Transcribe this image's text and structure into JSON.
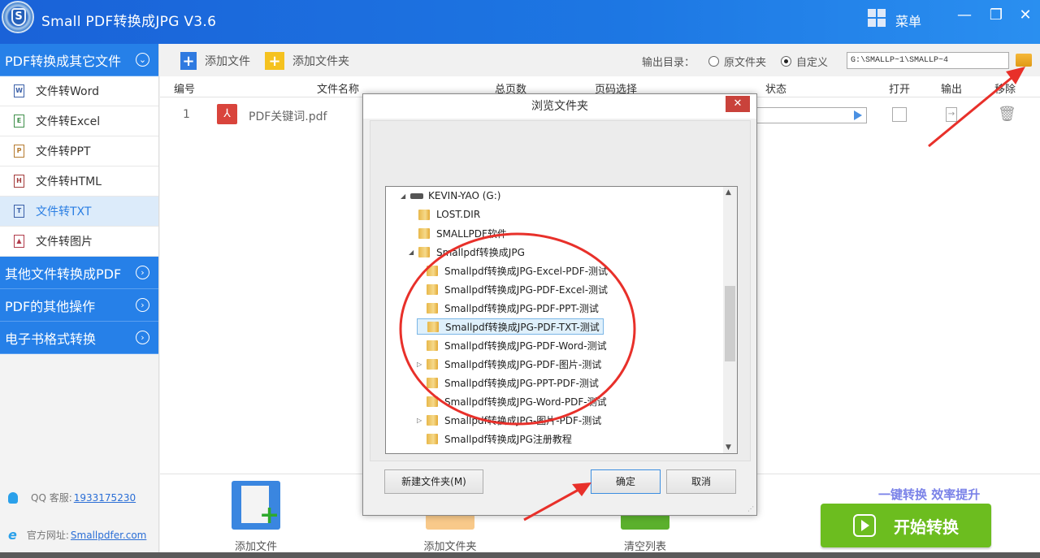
{
  "window": {
    "title": "Small  PDF转换成JPG V3.6",
    "menu_label": "菜单",
    "minimize": "—",
    "restore": "❐",
    "close": "✕"
  },
  "sidebar": {
    "category_main": "PDF转换成其它文件",
    "items": [
      {
        "label": "文件转Word",
        "icon": "word-file-icon",
        "glyph": "W",
        "color": "#3a5fa8"
      },
      {
        "label": "文件转Excel",
        "icon": "excel-file-icon",
        "glyph": "E",
        "color": "#3f8f4a"
      },
      {
        "label": "文件转PPT",
        "icon": "ppt-file-icon",
        "glyph": "P",
        "color": "#b57a2e"
      },
      {
        "label": "文件转HTML",
        "icon": "html-file-icon",
        "glyph": "H",
        "color": "#a33a3a"
      },
      {
        "label": "文件转TXT",
        "icon": "txt-file-icon",
        "glyph": "T",
        "color": "#3a5fa8",
        "active": true
      },
      {
        "label": "文件转图片",
        "icon": "image-file-icon",
        "glyph": "▲",
        "color": "#b03a4a"
      }
    ],
    "categories": [
      "其他文件转换成PDF",
      "PDF的其他操作",
      "电子书格式转换"
    ],
    "support": {
      "qq_label": "QQ 客服:",
      "qq_value": "1933175230",
      "site_label": "官方网址:",
      "site_value": "Smallpdfer.com"
    }
  },
  "toolbar": {
    "add_file": "添加文件",
    "add_folder": "添加文件夹",
    "output_label": "输出目录：",
    "radio_original": "原文件夹",
    "radio_custom": "自定义",
    "selected_radio": "custom",
    "output_path": "G:\\SMALLP~1\\SMALLP~4"
  },
  "table": {
    "columns": [
      "编号",
      "文件名称",
      "总页数",
      "页码选择",
      "状态",
      "打开",
      "输出",
      "移除"
    ],
    "rows": [
      {
        "index": "1",
        "name": "PDF关键词.pdf"
      }
    ]
  },
  "bottom": {
    "add_file": "添加文件",
    "add_folder": "添加文件夹",
    "clear_list": "清空列表",
    "slogan": "一键转换  效率提升",
    "start": "开始转换"
  },
  "dialog": {
    "title": "浏览文件夹",
    "close": "✕",
    "tree": [
      {
        "label": "KEVIN-YAO (G:)",
        "level": 0,
        "type": "drive",
        "expanded": true
      },
      {
        "label": "LOST.DIR",
        "level": 1,
        "type": "folder"
      },
      {
        "label": "SMALLPDF软件",
        "level": 1,
        "type": "folder"
      },
      {
        "label": "Smallpdf转换成JPG",
        "level": 1,
        "type": "folder",
        "expanded": true
      },
      {
        "label": "Smallpdf转换成JPG-Excel-PDF-测试",
        "level": 2,
        "type": "folder"
      },
      {
        "label": "Smallpdf转换成JPG-PDF-Excel-测试",
        "level": 2,
        "type": "folder"
      },
      {
        "label": "Smallpdf转换成JPG-PDF-PPT-测试",
        "level": 2,
        "type": "folder"
      },
      {
        "label": "Smallpdf转换成JPG-PDF-TXT-测试",
        "level": 2,
        "type": "folder",
        "selected": true
      },
      {
        "label": "Smallpdf转换成JPG-PDF-Word-测试",
        "level": 2,
        "type": "folder"
      },
      {
        "label": "Smallpdf转换成JPG-PDF-图片-测试",
        "level": 2,
        "type": "folder",
        "collapsed": true
      },
      {
        "label": "Smallpdf转换成JPG-PPT-PDF-测试",
        "level": 2,
        "type": "folder"
      },
      {
        "label": "Smallpdf转换成JPG-Word-PDF-测试",
        "level": 2,
        "type": "folder"
      },
      {
        "label": "Smallpdf转换成JPG-图片-PDF-测试",
        "level": 2,
        "type": "folder",
        "collapsed": true
      },
      {
        "label": "Smallpdf转换成JPG注册教程",
        "level": 2,
        "type": "folder"
      }
    ],
    "new_folder": "新建文件夹(M)",
    "ok": "确定",
    "cancel": "取消"
  },
  "colors": {
    "accent": "#2680e8",
    "start_button": "#6cbd1f",
    "annotation_red": "#e8302a",
    "slogan": "#7a82e8"
  }
}
